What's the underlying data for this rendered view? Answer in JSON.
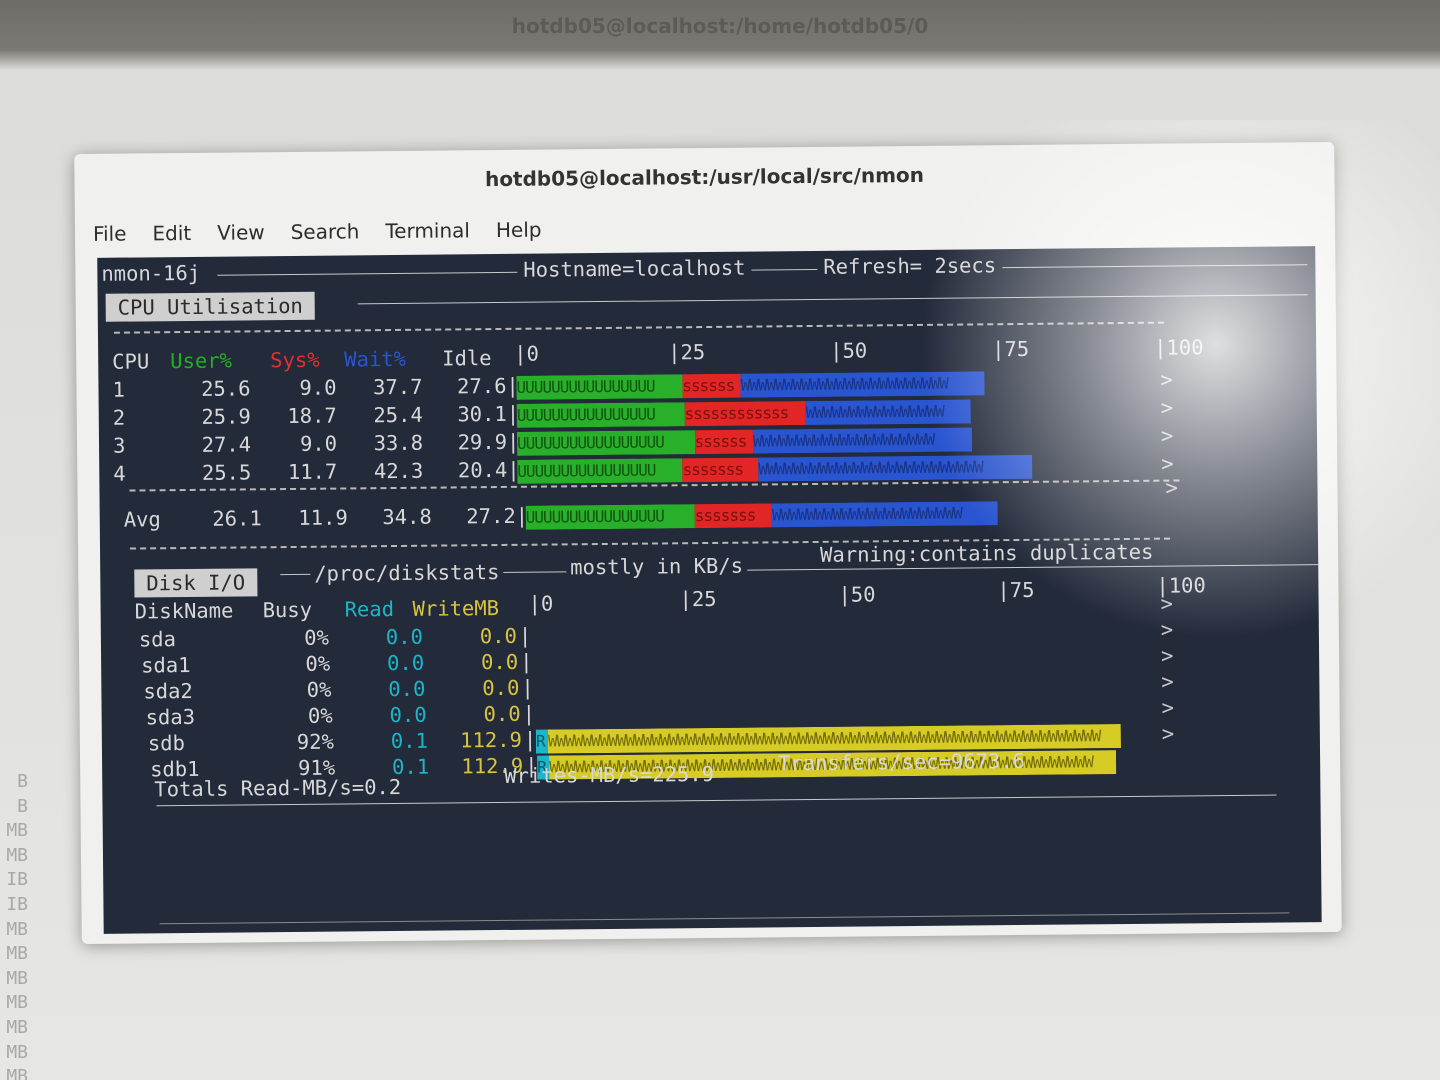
{
  "background": {
    "title": "hotdb05@localhost:/home/hotdb05/0",
    "side_texts": [
      "B",
      "B",
      "MB",
      "MB",
      "IB",
      "IB",
      "MB",
      "MB",
      "MB",
      "MB",
      "MB",
      "MB",
      "MB"
    ]
  },
  "window": {
    "title": "hotdb05@localhost:/usr/local/src/nmon",
    "menu": [
      "File",
      "Edit",
      "View",
      "Search",
      "Terminal",
      "Help"
    ]
  },
  "nmon": {
    "version": "nmon-16j",
    "hostname": "Hostname=localhost",
    "refresh": "Refresh= 2secs",
    "cpu_section_title": "CPU Utilisation",
    "cpu_header": {
      "cpu": "CPU",
      "user": "User%",
      "sys": "Sys%",
      "wait": "Wait%",
      "idle": "Idle"
    },
    "scale": {
      "s0": "0",
      "s25": "25",
      "s50": "50",
      "s75": "75",
      "s100": "100"
    },
    "cpus": [
      {
        "id": "1",
        "user": "25.6",
        "sys": "9.0",
        "wait": "37.7",
        "idle": "27.6"
      },
      {
        "id": "2",
        "user": "25.9",
        "sys": "18.7",
        "wait": "25.4",
        "idle": "30.1"
      },
      {
        "id": "3",
        "user": "27.4",
        "sys": "9.0",
        "wait": "33.8",
        "idle": "29.9"
      },
      {
        "id": "4",
        "user": "25.5",
        "sys": "11.7",
        "wait": "42.3",
        "idle": "20.4"
      }
    ],
    "avg": {
      "label": "Avg",
      "user": "26.1",
      "sys": "11.9",
      "wait": "34.8",
      "idle": "27.2"
    },
    "disk_section_title": "Disk I/O",
    "disk_source": "/proc/diskstats",
    "disk_units": "mostly in KB/s",
    "disk_warning": "Warning:contains duplicates",
    "disk_header": {
      "name": "DiskName",
      "busy": "Busy",
      "read": "Read",
      "write": "WriteMB"
    },
    "disks": [
      {
        "name": "sda",
        "busy": "0%",
        "read": "0.0",
        "write": "0.0",
        "busy_pct": 0
      },
      {
        "name": "sda1",
        "busy": "0%",
        "read": "0.0",
        "write": "0.0",
        "busy_pct": 0
      },
      {
        "name": "sda2",
        "busy": "0%",
        "read": "0.0",
        "write": "0.0",
        "busy_pct": 0
      },
      {
        "name": "sda3",
        "busy": "0%",
        "read": "0.0",
        "write": "0.0",
        "busy_pct": 0
      },
      {
        "name": "sdb",
        "busy": "92%",
        "read": "0.1",
        "write": "112.9",
        "busy_pct": 92
      },
      {
        "name": "sdb1",
        "busy": "91%",
        "read": "0.1",
        "write": "112.9",
        "busy_pct": 91
      }
    ],
    "totals": {
      "read": "Totals Read-MB/s=0.2",
      "writes": "Writes-MB/s=225.9",
      "transfers": "Transfers/sec=9673.6"
    },
    "colors": {
      "user": "#29b02a",
      "sys": "#e22525",
      "wait": "#2a55d0",
      "disk_write": "#d7cc26",
      "disk_read": "#1cb5c9"
    }
  }
}
